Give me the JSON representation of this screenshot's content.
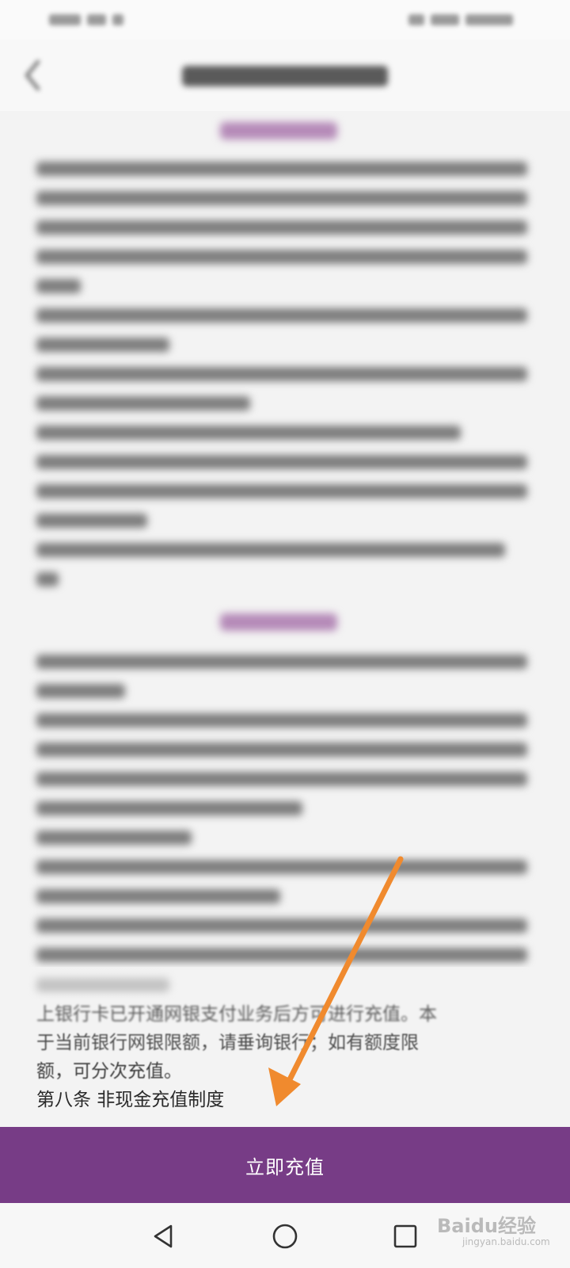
{
  "content": {
    "lines": [
      "上银行卡已开通网银支付业务后方可进行充值。本",
      "于当前银行网银限额，请垂询银行；如有额度限",
      "额，可分次充值。",
      "第八条 非现金充值制度"
    ]
  },
  "cta": {
    "label": "立即充值"
  },
  "watermark": {
    "brand": "Baidu经验",
    "url": "jingyan.baidu.com"
  },
  "colors": {
    "accent": "#773c86",
    "arrow": "#f08a2e",
    "section_heading": "#b58ab8"
  },
  "icons": {
    "back": "chevron-left-icon",
    "nav_back": "triangle-back-icon",
    "nav_home": "circle-home-icon",
    "nav_recents": "square-recents-icon"
  }
}
